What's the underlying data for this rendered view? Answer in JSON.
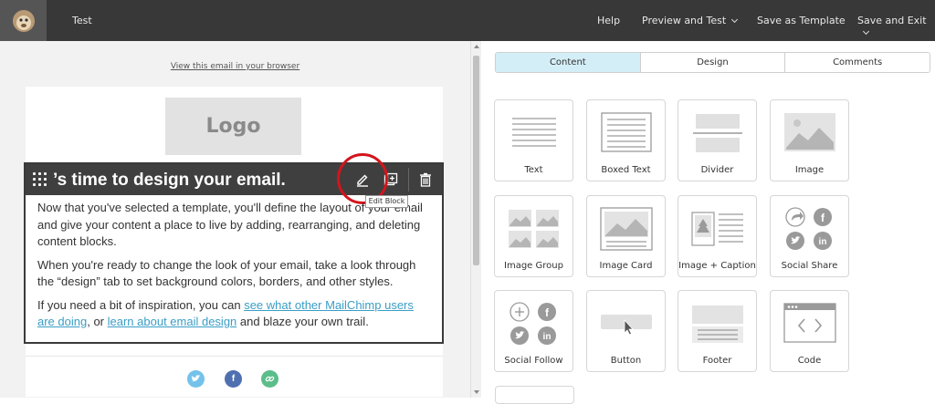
{
  "topbar": {
    "title": "Test",
    "menu": {
      "help": "Help",
      "preview_and_test": "Preview and Test",
      "save_as_template": "Save as Template",
      "save_and_exit": "Save and Exit"
    }
  },
  "email": {
    "view_in_browser": "View this email in your browser",
    "logo_placeholder": "Logo",
    "block": {
      "heading": "’s time to design your email.",
      "tooltip": "Edit Block",
      "p1": "Now that you've selected a template, you'll define the layout of your email and give your content a place to live by adding, rearranging, and deleting content blocks.",
      "p2": "When you're ready to change the look of your email, take a look through the “design” tab to set background colors, borders, and other styles.",
      "p3_a": "If you need a bit of inspiration, you can ",
      "p3_link1": "see what other MailChimp users are doing",
      "p3_b": ", or ",
      "p3_link2": "learn about email design",
      "p3_c": " and blaze your own trail."
    }
  },
  "panel": {
    "tabs": [
      "Content",
      "Design",
      "Comments"
    ],
    "active_tab": "Content",
    "tiles": [
      {
        "label": "Text",
        "icon": "text-icon"
      },
      {
        "label": "Boxed Text",
        "icon": "boxed-text-icon"
      },
      {
        "label": "Divider",
        "icon": "divider-icon"
      },
      {
        "label": "Image",
        "icon": "image-icon"
      },
      {
        "label": "Image Group",
        "icon": "image-group-icon"
      },
      {
        "label": "Image Card",
        "icon": "image-card-icon"
      },
      {
        "label": "Image + Caption",
        "icon": "image-caption-icon"
      },
      {
        "label": "Social Share",
        "icon": "social-share-icon"
      },
      {
        "label": "Social Follow",
        "icon": "social-follow-icon"
      },
      {
        "label": "Button",
        "icon": "button-icon"
      },
      {
        "label": "Footer",
        "icon": "footer-icon"
      },
      {
        "label": "Code",
        "icon": "code-icon"
      }
    ]
  },
  "colors": {
    "topbar": "#383838",
    "active_tab": "#d3eef7",
    "link": "#3a9ec6",
    "highlight_circle": "#d4141c",
    "twitter": "#55acee",
    "facebook": "#3b5998",
    "link_icon": "#4caf7a"
  }
}
